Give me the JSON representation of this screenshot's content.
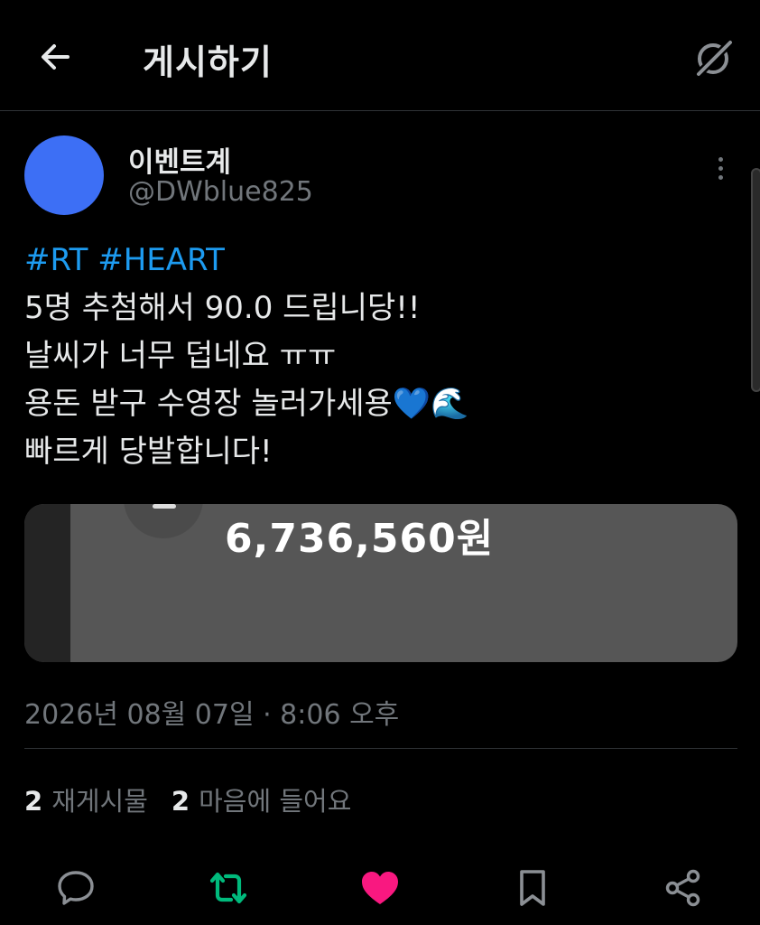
{
  "header": {
    "title": "게시하기",
    "back_icon": "arrow-left-icon",
    "grok_icon": "grok-icon"
  },
  "post": {
    "author_name": "이벤트계",
    "author_handle": "@DWblue825",
    "avatar_color": "#3d6ff5",
    "hashtags": [
      "#RT",
      "#HEART"
    ],
    "lines": [
      "5명 추첨해서 90.0 드립니당!!",
      "날씨가 너무 덥네요 ㅠㅠ",
      "용돈 받구 수영장 놀러가세용💙🌊",
      "빠르게 당발합니다!"
    ],
    "media_amount": "6,736,560원",
    "timestamp": "2026년 08월 07일 · 8:06 오후"
  },
  "stats": {
    "reposts_count": "2",
    "reposts_label": "재게시물",
    "likes_count": "2",
    "likes_label": "마음에 들어요"
  },
  "actions": {
    "reply_icon": "reply-icon",
    "repost_icon": "repost-icon",
    "repost_color": "#00ba7c",
    "like_icon": "heart-icon",
    "like_color": "#f91880",
    "bookmark_icon": "bookmark-icon",
    "share_icon": "share-icon"
  }
}
